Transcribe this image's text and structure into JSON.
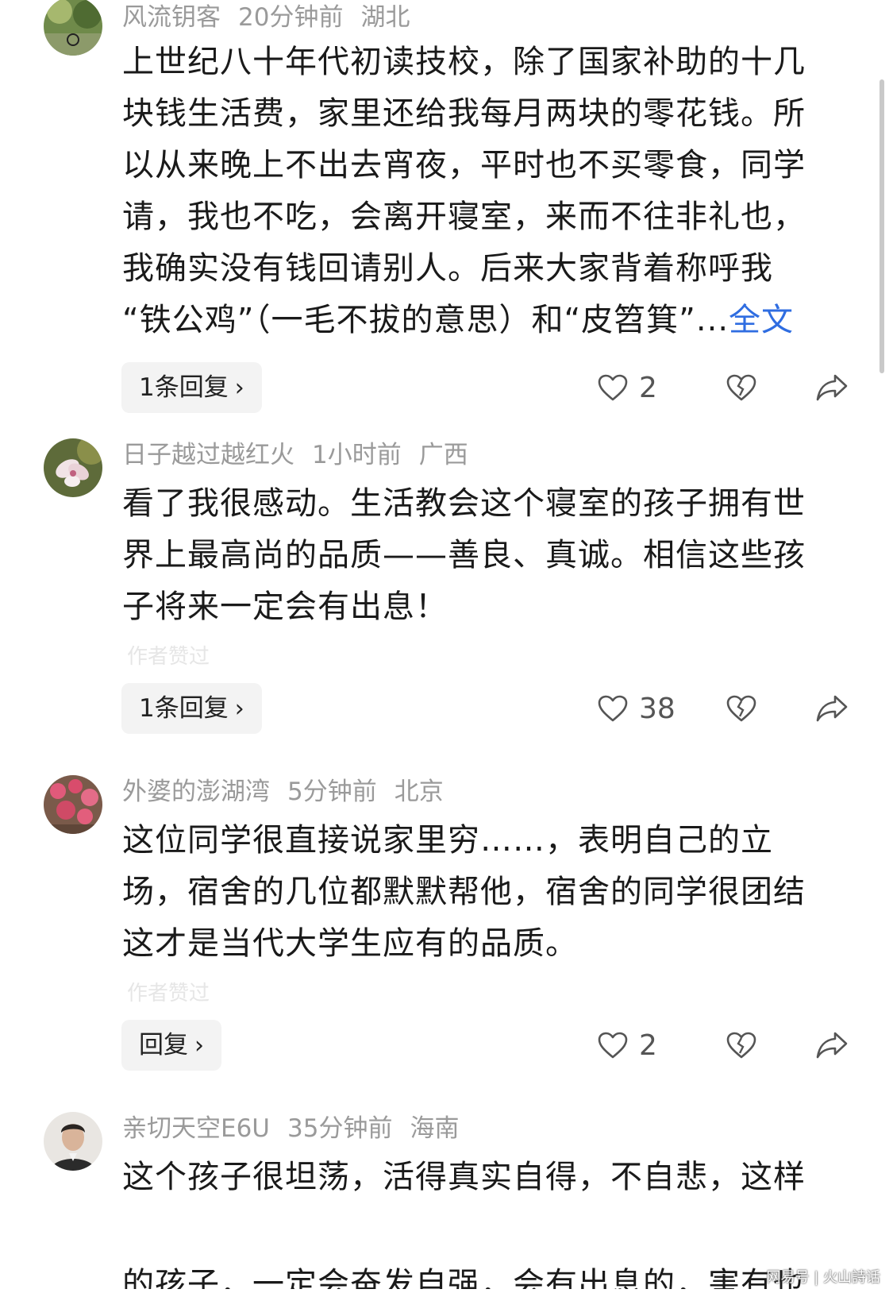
{
  "comments": [
    {
      "username": "风流钥客",
      "time": "20分钟前",
      "location": "湖北",
      "lines": [
        "上世纪八十年代初读技校，除了国家补助的十几",
        "块钱生活费，家里还给我每月两块的零花钱。所",
        "以从来晚上不出去宵夜，平时也不买零食，同学",
        "请，我也不吃，会离开寝室，来而不往非礼也，",
        "我确实没有钱回请别人。后来大家背着称呼我",
        "“铁公鸡”（一毛不拔的意思）和“皮笤箕”..."
      ],
      "full_text_link": "全文",
      "reply_label": "1条回复",
      "likes": "2"
    },
    {
      "username": "日子越过越红火",
      "time": "1小时前",
      "location": "广西",
      "lines": [
        "看了我很感动。生活教会这个寝室的孩子拥有世",
        "界上最高尚的品质——善良、真诚。相信这些孩",
        "子将来一定会有出息！"
      ],
      "ghost_label": "作者赞过",
      "reply_label": "1条回复",
      "likes": "38"
    },
    {
      "username": "外婆的澎湖湾",
      "time": "5分钟前",
      "location": "北京",
      "lines": [
        "这位同学很直接说家里穷……，表明自己的立",
        "场，宿舍的几位都默默帮他，宿舍的同学很团结",
        "这才是当代大学生应有的品质。"
      ],
      "ghost_label": "作者赞过",
      "reply_label": "回复",
      "likes": "2"
    },
    {
      "username": "亲切天空E6U",
      "time": "35分钟前",
      "location": "海南",
      "lines": [
        "这个孩子很坦荡，活得真实自得，不自悲，这样",
        "的孩子，一定会奋发自强，会有出息的，害有也"
      ]
    }
  ],
  "watermark": "网易号 | 火山詩话",
  "icons": {
    "like": "heart-outline-icon",
    "dislike": "broken-heart-icon",
    "share": "share-arrow-icon",
    "chevron": "chevron-right-icon"
  },
  "colors": {
    "text": "#1a1a1a",
    "meta": "#9a9a9a",
    "link": "#2f6de1",
    "reply_bg": "#f3f3f3"
  }
}
